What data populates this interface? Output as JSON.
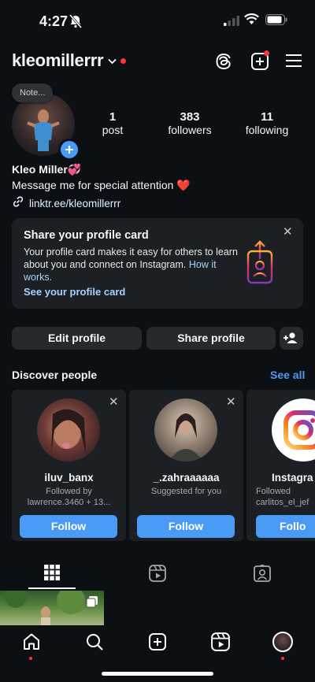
{
  "status": {
    "time": "4:27"
  },
  "header": {
    "username": "kleomillerrr"
  },
  "profile": {
    "note": "Note...",
    "posts": {
      "count": "1",
      "label": "post"
    },
    "followers": {
      "count": "383",
      "label": "followers"
    },
    "following": {
      "count": "11",
      "label": "following"
    },
    "name": "Kleo Miller💞",
    "bio": "Message me for special attention ❤️",
    "link": "linktr.ee/kleomillerrr"
  },
  "share_card": {
    "title": "Share your profile card",
    "body": "Your profile card makes it easy for others to learn about you and connect on Instagram.",
    "how_link": "How it works.",
    "cta": "See your profile card"
  },
  "actions": {
    "edit": "Edit profile",
    "share": "Share profile"
  },
  "discover": {
    "title": "Discover people",
    "see_all": "See all",
    "cards": [
      {
        "name": "iluv_banx",
        "sub": "Followed by lawrence.3460 + 13...",
        "button": "Follow"
      },
      {
        "name": "_.zahraaaaaa",
        "sub": "Suggested for you",
        "button": "Follow"
      },
      {
        "name": "Instagra",
        "sub": "Followed carlitos_el_jef",
        "button": "Follo"
      }
    ]
  },
  "colors": {
    "accent": "#4a9bf6",
    "background": "#0c1014",
    "badge": "#ff3040",
    "link": "#e0f1ff"
  }
}
